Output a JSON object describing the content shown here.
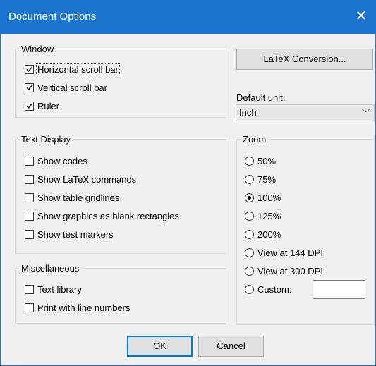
{
  "dialog": {
    "title": "Document Options",
    "close": "✕"
  },
  "window_group": {
    "legend": "Window",
    "items": [
      {
        "label": "Horizontal scroll bar",
        "checked": true
      },
      {
        "label": "Vertical scroll bar",
        "checked": true
      },
      {
        "label": "Ruler",
        "checked": true
      }
    ]
  },
  "text_display_group": {
    "legend": "Text Display",
    "items": [
      {
        "label": "Show codes",
        "checked": false
      },
      {
        "label": "Show LaTeX commands",
        "checked": false
      },
      {
        "label": "Show table gridlines",
        "checked": false
      },
      {
        "label": "Show graphics as blank rectangles",
        "checked": false
      },
      {
        "label": "Show test markers",
        "checked": false
      }
    ]
  },
  "misc_group": {
    "legend": "Miscellaneous",
    "items": [
      {
        "label": "Text library",
        "checked": false
      },
      {
        "label": "Print with line numbers",
        "checked": false
      }
    ]
  },
  "latex_button": "LaTeX Conversion...",
  "default_unit": {
    "label": "Default unit:",
    "value": "Inch"
  },
  "zoom_group": {
    "legend": "Zoom",
    "options": [
      {
        "label": "50%",
        "selected": false
      },
      {
        "label": "75%",
        "selected": false
      },
      {
        "label": "100%",
        "selected": true
      },
      {
        "label": "125%",
        "selected": false
      },
      {
        "label": "200%",
        "selected": false
      },
      {
        "label": "View at 144 DPI",
        "selected": false
      },
      {
        "label": "View at 300 DPI",
        "selected": false
      },
      {
        "label": "Custom:",
        "selected": false
      }
    ],
    "custom_value": ""
  },
  "buttons": {
    "ok": "OK",
    "cancel": "Cancel"
  }
}
